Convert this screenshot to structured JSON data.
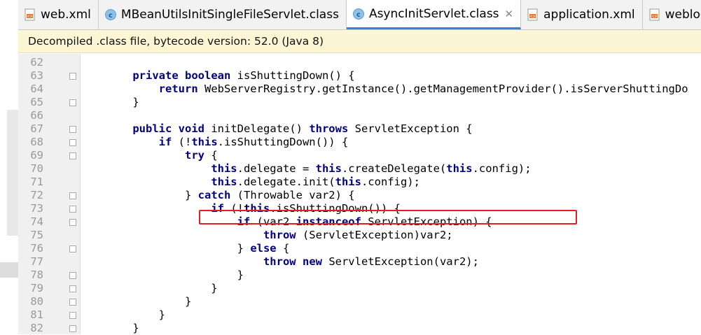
{
  "tabs": [
    {
      "label": "web.xml",
      "icon": "xml-file-icon",
      "active": false
    },
    {
      "label": "MBeanUtilsInitSingleFileServlet.class",
      "icon": "class-file-icon",
      "active": false
    },
    {
      "label": "AsyncInitServlet.class",
      "icon": "class-file-icon",
      "active": true
    },
    {
      "label": "application.xml",
      "icon": "xml-file-icon",
      "active": false
    },
    {
      "label": "weblogic-app",
      "icon": "xml-file-icon",
      "active": false
    }
  ],
  "close_glyph": "✕",
  "banner": "Decompiled .class file, bytecode version: 52.0 (Java 8)",
  "code_lines": [
    {
      "n": "62",
      "t": ""
    },
    {
      "n": "63",
      "t": "    private boolean isShuttingDown() {"
    },
    {
      "n": "64",
      "t": "        return WebServerRegistry.getInstance().getManagementProvider().isServerShuttingDo"
    },
    {
      "n": "65",
      "t": "    }"
    },
    {
      "n": "66",
      "t": ""
    },
    {
      "n": "67",
      "t": "    public void initDelegate() throws ServletException {"
    },
    {
      "n": "68",
      "t": "        if (!this.isShuttingDown()) {"
    },
    {
      "n": "69",
      "t": "            try {"
    },
    {
      "n": "70",
      "t": "                this.delegate = this.createDelegate(this.config);"
    },
    {
      "n": "71",
      "t": "                this.delegate.init(this.config);"
    },
    {
      "n": "72",
      "t": "            } catch (Throwable var2) {"
    },
    {
      "n": "73",
      "t": "                if (!this.isShuttingDown()) {"
    },
    {
      "n": "74",
      "t": "                    if (var2 instanceof ServletException) {"
    },
    {
      "n": "75",
      "t": "                        throw (ServletException)var2;"
    },
    {
      "n": "76",
      "t": "                    } else {"
    },
    {
      "n": "77",
      "t": "                        throw new ServletException(var2);"
    },
    {
      "n": "78",
      "t": "                    }"
    },
    {
      "n": "79",
      "t": "                }"
    },
    {
      "n": "80",
      "t": "            }"
    },
    {
      "n": "81",
      "t": "        }"
    },
    {
      "n": "82",
      "t": "    }"
    }
  ],
  "colors": {
    "keyword": "#000080",
    "highlight_border": "#e02020",
    "banner_bg": "#fdf6d5",
    "active_tab_underline": "#3f7fd6"
  }
}
